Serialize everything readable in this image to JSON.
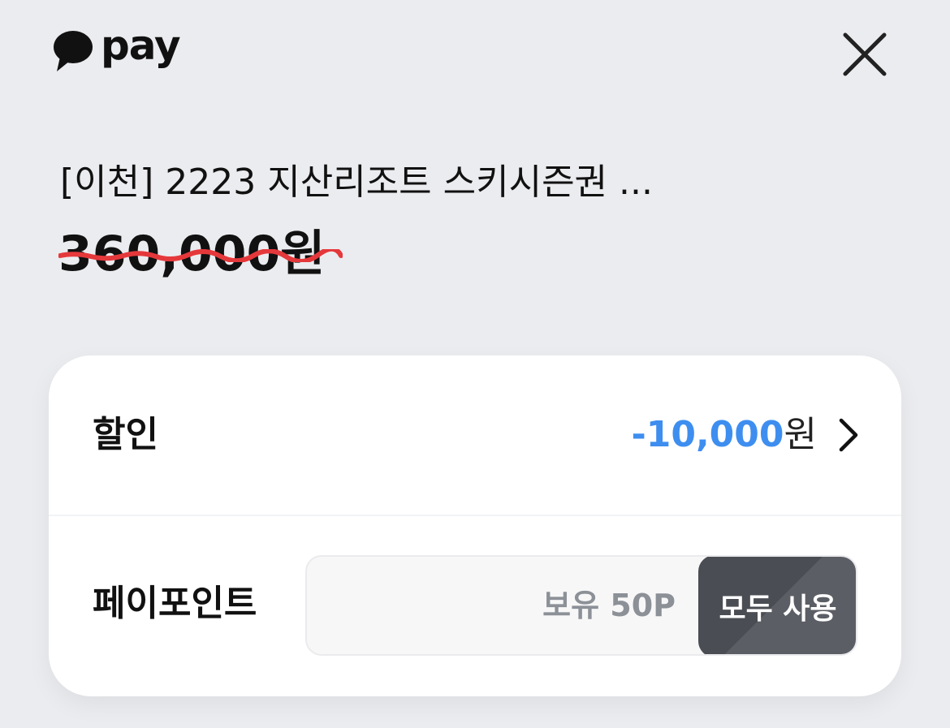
{
  "header": {
    "logo_text": "pay",
    "close_label": "×"
  },
  "product": {
    "title": "[이천] 2223 지산리조트 스키시즌권 ...",
    "original_price": "360,000원"
  },
  "discount": {
    "label": "할인",
    "amount": "-10,000",
    "unit": "원"
  },
  "points": {
    "label": "페이포인트",
    "placeholder": "보유 50P",
    "use_all_label": "모두 사용"
  },
  "colors": {
    "background": "#ebecef",
    "card": "#ffffff",
    "accent_blue": "#3e8ef0",
    "strike_red": "#e5383b",
    "button_dark": "#4a4d53"
  }
}
